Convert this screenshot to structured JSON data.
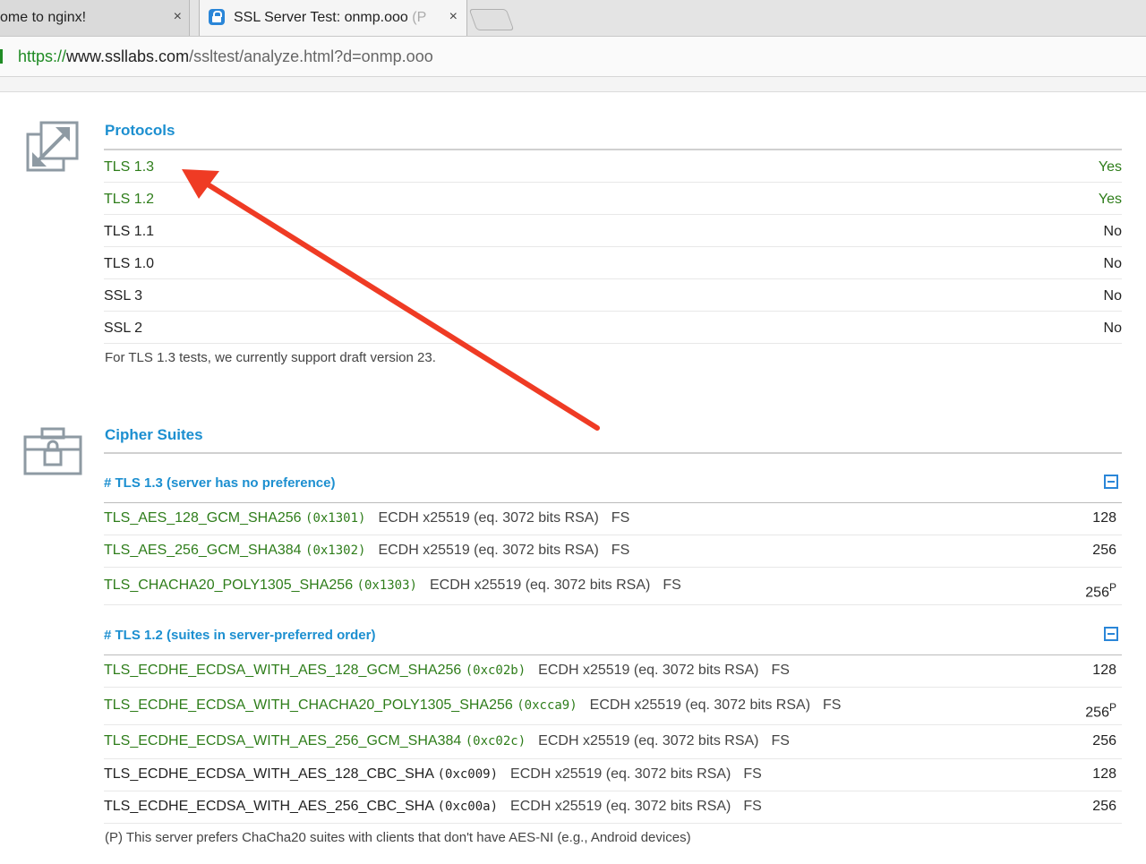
{
  "browser": {
    "tabs": [
      {
        "title": "ome to nginx!",
        "close": "×"
      },
      {
        "title": "SSL Server Test: onmp.ooo",
        "title_fade": "(Po",
        "close": "×"
      }
    ],
    "url": {
      "scheme": "https://",
      "host": "www.ssllabs.com",
      "path": "/ssltest/analyze.html?d=onmp.ooo"
    }
  },
  "protocols": {
    "title": "Protocols",
    "rows": [
      {
        "name": "TLS 1.3",
        "value": "Yes",
        "enabled": true
      },
      {
        "name": "TLS 1.2",
        "value": "Yes",
        "enabled": true
      },
      {
        "name": "TLS 1.1",
        "value": "No",
        "enabled": false
      },
      {
        "name": "TLS 1.0",
        "value": "No",
        "enabled": false
      },
      {
        "name": "SSL 3",
        "value": "No",
        "enabled": false
      },
      {
        "name": "SSL 2",
        "value": "No",
        "enabled": false
      }
    ],
    "note": "For TLS 1.3 tests, we currently support draft version 23."
  },
  "cipher_suites": {
    "title": "Cipher Suites",
    "groups": [
      {
        "heading": "# TLS 1.3 (server has no preference)",
        "suites": [
          {
            "name": "TLS_AES_128_GCM_SHA256",
            "code": "(0x1301)",
            "info": "ECDH x25519 (eq. 3072 bits RSA)",
            "fs": "FS",
            "bits": "128",
            "sup": "",
            "color": "green"
          },
          {
            "name": "TLS_AES_256_GCM_SHA384",
            "code": "(0x1302)",
            "info": "ECDH x25519 (eq. 3072 bits RSA)",
            "fs": "FS",
            "bits": "256",
            "sup": "",
            "color": "green"
          },
          {
            "name": "TLS_CHACHA20_POLY1305_SHA256",
            "code": "(0x1303)",
            "info": "ECDH x25519 (eq. 3072 bits RSA)",
            "fs": "FS",
            "bits": "256",
            "sup": "P",
            "color": "green"
          }
        ]
      },
      {
        "heading": "# TLS 1.2 (suites in server-preferred order)",
        "suites": [
          {
            "name": "TLS_ECDHE_ECDSA_WITH_AES_128_GCM_SHA256",
            "code": "(0xc02b)",
            "info": "ECDH x25519 (eq. 3072 bits RSA)",
            "fs": "FS",
            "bits": "128",
            "sup": "",
            "color": "green"
          },
          {
            "name": "TLS_ECDHE_ECDSA_WITH_CHACHA20_POLY1305_SHA256",
            "code": "(0xcca9)",
            "info": "ECDH x25519 (eq. 3072 bits RSA)",
            "fs": "FS",
            "bits": "256",
            "sup": "P",
            "color": "green"
          },
          {
            "name": "TLS_ECDHE_ECDSA_WITH_AES_256_GCM_SHA384",
            "code": "(0xc02c)",
            "info": "ECDH x25519 (eq. 3072 bits RSA)",
            "fs": "FS",
            "bits": "256",
            "sup": "",
            "color": "green"
          },
          {
            "name": "TLS_ECDHE_ECDSA_WITH_AES_128_CBC_SHA",
            "code": "(0xc009)",
            "info": "ECDH x25519 (eq. 3072 bits RSA)",
            "fs": "FS",
            "bits": "128",
            "sup": "",
            "color": "black"
          },
          {
            "name": "TLS_ECDHE_ECDSA_WITH_AES_256_CBC_SHA",
            "code": "(0xc00a)",
            "info": "ECDH x25519 (eq. 3072 bits RSA)",
            "fs": "FS",
            "bits": "256",
            "sup": "",
            "color": "black"
          }
        ]
      }
    ],
    "footnote": "(P) This server prefers ChaCha20 suites with clients that don't have AES-NI (e.g., Android devices)"
  },
  "colors": {
    "accent": "#1c8fd0",
    "green": "#2e7d1a",
    "annotation_arrow": "#ef3b24"
  },
  "icons": {
    "protocols": "expand-arrows-icon",
    "ciphers": "locked-briefcase-icon"
  }
}
